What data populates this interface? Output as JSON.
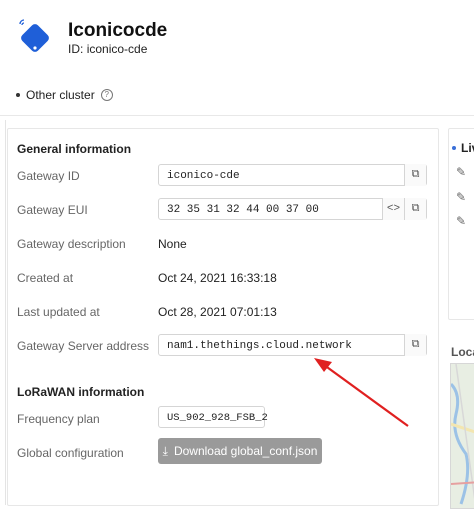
{
  "header": {
    "title": "Iconicocde",
    "id_label": "ID:",
    "id_value": "iconico-cde"
  },
  "cluster": {
    "label": "Other cluster"
  },
  "general": {
    "title": "General information",
    "gateway_id": {
      "label": "Gateway ID",
      "value": "iconico-cde"
    },
    "gateway_eui": {
      "label": "Gateway EUI",
      "value": "32 35 31 32 44 00 37 00"
    },
    "gateway_description": {
      "label": "Gateway description",
      "value": "None"
    },
    "created_at": {
      "label": "Created at",
      "value": "Oct 24, 2021 16:33:18"
    },
    "last_updated_at": {
      "label": "Last updated at",
      "value": "Oct 28, 2021 07:01:13"
    },
    "gateway_server_address": {
      "label": "Gateway Server address",
      "value": "nam1.thethings.cloud.network"
    }
  },
  "lorawan": {
    "title": "LoRaWAN information",
    "frequency_plan": {
      "label": "Frequency plan",
      "value": "US_902_928_FSB_2"
    },
    "global_configuration": {
      "label": "Global configuration",
      "button_label": "Download global_conf.json"
    }
  },
  "right": {
    "live_title": "Liv",
    "location_title": "Loca"
  },
  "colors": {
    "accent_blue": "#1f5fd8",
    "annotation_red": "#e02020",
    "button_gray": "#9a9a9a"
  }
}
